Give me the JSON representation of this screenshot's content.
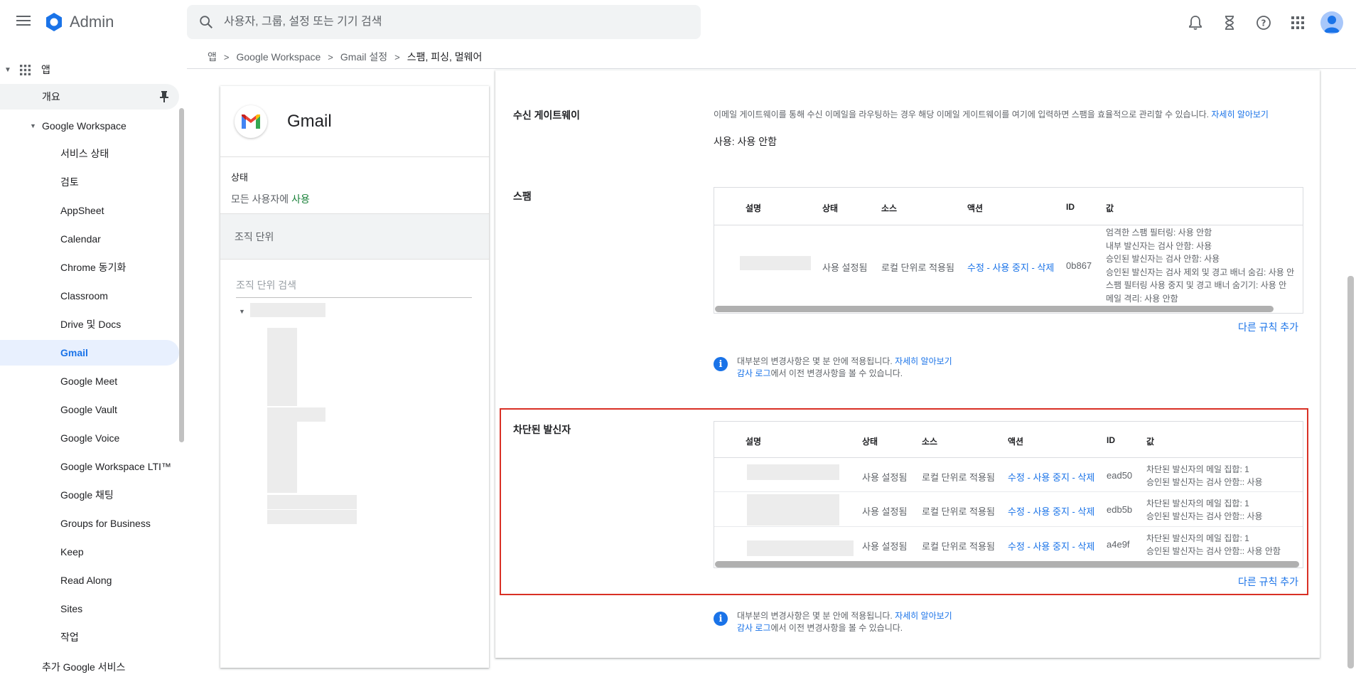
{
  "app": {
    "title": "Admin"
  },
  "search": {
    "placeholder": "사용자, 그룹, 설정 또는 기기 검색"
  },
  "breadcrumb": [
    "앱",
    "Google Workspace",
    "Gmail 설정",
    "스팸, 피싱, 멀웨어"
  ],
  "sidebar": {
    "apps_label": "앱",
    "overview": "개요",
    "workspace": "Google Workspace",
    "items": [
      "서비스 상태",
      "검토",
      "AppSheet",
      "Calendar",
      "Chrome 동기화",
      "Classroom",
      "Drive 및 Docs",
      "Gmail",
      "Google Meet",
      "Google Vault",
      "Google Voice",
      "Google Workspace LTI™",
      "Google 채팅",
      "Groups for Business",
      "Keep",
      "Read Along",
      "Sites",
      "작업"
    ],
    "more": "추가 Google 서비스"
  },
  "left_panel": {
    "app_name": "Gmail",
    "status_label": "상태",
    "status_prefix": "모든 사용자에 ",
    "status_value": "사용",
    "org_unit_label": "조직 단위",
    "org_search_placeholder": "조직 단위 검색"
  },
  "inbound_gateway": {
    "title": "수신 게이트웨이",
    "description": "이메일 게이트웨이를 통해 수신 이메일을 라우팅하는 경우 해당 이메일 게이트웨이를 여기에 입력하면 스팸을 효율적으로 관리할 수 있습니다.",
    "learn_more": "자세히 알아보기",
    "usage": "사용: 사용 안함"
  },
  "spam": {
    "title": "스팸",
    "headers": [
      "설명",
      "상태",
      "소스",
      "액션",
      "ID",
      "값"
    ],
    "row": {
      "status": "사용 설정됨",
      "source": "로컬 단위로 적용됨",
      "action": "수정 - 사용 중지 - 삭제",
      "id": "0b867",
      "values": [
        "엄격한 스팸 필터링: 사용 안함",
        "내부 발신자는 검사 안함: 사용",
        "승인된 발신자는 검사 안함: 사용",
        "승인된 발신자는 검사 제외 및 경고 배너 숨김: 사용 안",
        "스팸 필터링 사용 중지 및 경고 배너 숨기기: 사용 안",
        "메일 격리: 사용 안함"
      ]
    },
    "add_rule": "다른 규칙 추가"
  },
  "notice": {
    "line1": "대부분의 변경사항은 몇 분 안에 적용됩니다.",
    "learn_more": "자세히 알아보기",
    "audit_link": "감사 로그",
    "line2_rest": "에서 이전 변경사항을 볼 수 있습니다."
  },
  "blocked": {
    "title": "차단된 발신자",
    "headers": [
      "설명",
      "상태",
      "소스",
      "액션",
      "ID",
      "값"
    ],
    "rows": [
      {
        "status": "사용 설정됨",
        "source": "로컬 단위로 적용됨",
        "action": "수정 - 사용 중지 - 삭제",
        "id": "ead50",
        "value1": "차단된 발신자의 메일 집합: 1",
        "value2": "승인된 발신자는 검사 안함:: 사용"
      },
      {
        "status": "사용 설정됨",
        "source": "로컬 단위로 적용됨",
        "action": "수정 - 사용 중지 - 삭제",
        "id": "edb5b",
        "value1": "차단된 발신자의 메일 집합: 1",
        "value2": "승인된 발신자는 검사 안함:: 사용"
      },
      {
        "status": "사용 설정됨",
        "source": "로컬 단위로 적용됨",
        "action": "수정 - 사용 중지 - 삭제",
        "id": "a4e9f",
        "value1": "차단된 발신자의 메일 집합: 1",
        "value2": "승인된 발신자는 검사 안함:: 사용 안함"
      }
    ],
    "add_rule": "다른 규칙 추가"
  },
  "colors": {
    "accent": "#1a73e8",
    "highlight": "#d93025",
    "enabled": "#188038"
  }
}
